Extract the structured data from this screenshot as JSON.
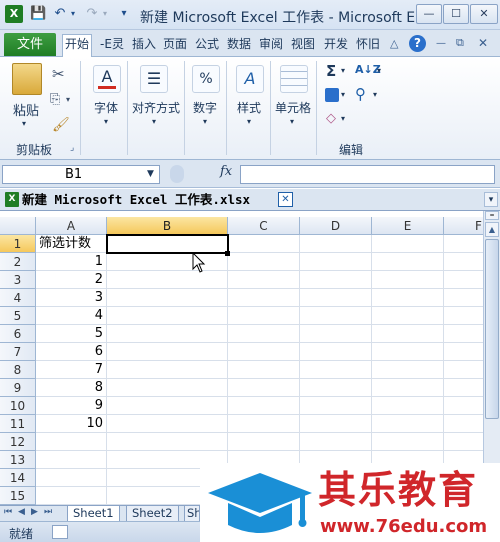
{
  "window": {
    "title": "新建 Microsoft Excel 工作表 - Microsoft E...",
    "min_label": "—",
    "max_label": "☐",
    "close_label": "✕"
  },
  "tabs": [
    "文件",
    "开始",
    "-E灵",
    "插入",
    "页面",
    "公式",
    "数据",
    "审阅",
    "视图",
    "开发",
    "怀旧"
  ],
  "ribbon": {
    "paste_label": "粘贴",
    "clipboard_label": "剪贴板",
    "font_label": "字体",
    "align_label": "对齐方式",
    "number_label": "数字",
    "style_label": "样式",
    "cells_label": "单元格",
    "edit_label": "编辑",
    "sum_glyph": "Σ",
    "font_color_glyph": "A",
    "percent_glyph": "%",
    "style_glyph": "A",
    "sort_glyph": "A↓Z",
    "find_glyph": "⚲"
  },
  "formula_bar": {
    "name_box": "B1",
    "fx_label": "fx",
    "formula": ""
  },
  "document": {
    "tab_name": "新建 Microsoft Excel 工作表.xlsx"
  },
  "sheet": {
    "columns": [
      "A",
      "B",
      "C",
      "D",
      "E",
      "F"
    ],
    "selected_col": "B",
    "selected_cell": "B1",
    "rows": [
      {
        "n": "1",
        "a": "筛选计数"
      },
      {
        "n": "2",
        "a": "1"
      },
      {
        "n": "3",
        "a": "2"
      },
      {
        "n": "4",
        "a": "3"
      },
      {
        "n": "5",
        "a": "4"
      },
      {
        "n": "6",
        "a": "5"
      },
      {
        "n": "7",
        "a": "6"
      },
      {
        "n": "8",
        "a": "7"
      },
      {
        "n": "9",
        "a": "8"
      },
      {
        "n": "10",
        "a": "9"
      },
      {
        "n": "11",
        "a": "10"
      },
      {
        "n": "12",
        "a": ""
      },
      {
        "n": "13",
        "a": ""
      },
      {
        "n": "14",
        "a": ""
      },
      {
        "n": "15",
        "a": ""
      }
    ]
  },
  "sheet_tabs": [
    "Sheet1",
    "Sheet2",
    "Sh"
  ],
  "status": {
    "ready": "就绪"
  },
  "watermark": {
    "cn": "其乐教育",
    "url": "www.76edu.com"
  },
  "colors": {
    "file_tab": "#2a8a2f",
    "selected_header": "#f5c85c",
    "watermark_blue": "#1a8fd6",
    "watermark_red": "#d0262a"
  }
}
